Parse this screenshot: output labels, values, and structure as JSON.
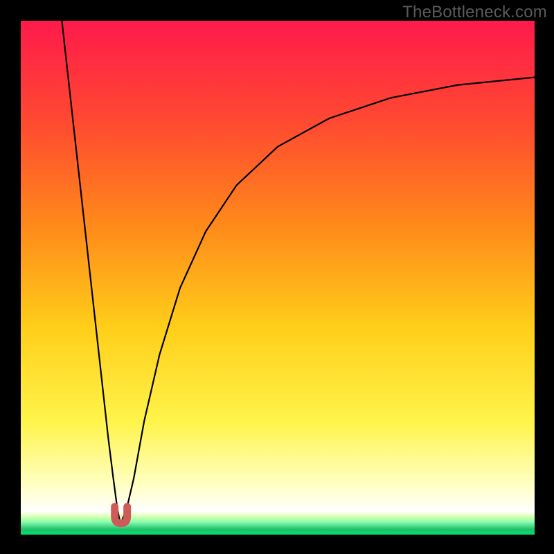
{
  "watermark": "TheBottleneck.com",
  "chart_data": {
    "type": "line",
    "title": "",
    "xlabel": "",
    "ylabel": "",
    "xlim": [
      0,
      100
    ],
    "ylim": [
      0,
      100
    ],
    "grid": false,
    "legend": false,
    "background_gradient": {
      "stops": [
        {
          "offset": 0.0,
          "color": "#ff1a4b"
        },
        {
          "offset": 0.2,
          "color": "#ff4a30"
        },
        {
          "offset": 0.4,
          "color": "#ff8a1a"
        },
        {
          "offset": 0.6,
          "color": "#ffcf1a"
        },
        {
          "offset": 0.78,
          "color": "#fff44a"
        },
        {
          "offset": 0.9,
          "color": "#ffffc0"
        },
        {
          "offset": 0.955,
          "color": "#ffffff"
        },
        {
          "offset": 0.965,
          "color": "#d8ffb0"
        },
        {
          "offset": 0.975,
          "color": "#8affb0"
        },
        {
          "offset": 0.99,
          "color": "#1fbf6a"
        },
        {
          "offset": 1.0,
          "color": "#00e56a"
        }
      ]
    },
    "marker": {
      "x": 19.5,
      "y": 3.0,
      "color": "#cf5a5a",
      "shape": "u"
    },
    "series": [
      {
        "name": "left-branch",
        "x": [
          8.0,
          10.0,
          12.0,
          14.0,
          16.0,
          17.0,
          18.0,
          18.8,
          19.2
        ],
        "y": [
          100.0,
          82.0,
          64.0,
          46.0,
          28.0,
          19.0,
          11.0,
          5.0,
          3.0
        ]
      },
      {
        "name": "right-branch",
        "x": [
          19.8,
          20.6,
          22.0,
          24.0,
          27.0,
          31.0,
          36.0,
          42.0,
          50.0,
          60.0,
          72.0,
          85.0,
          100.0
        ],
        "y": [
          3.0,
          5.0,
          11.0,
          22.0,
          35.0,
          48.0,
          59.0,
          68.0,
          75.5,
          81.0,
          85.0,
          87.5,
          89.0
        ]
      }
    ]
  }
}
